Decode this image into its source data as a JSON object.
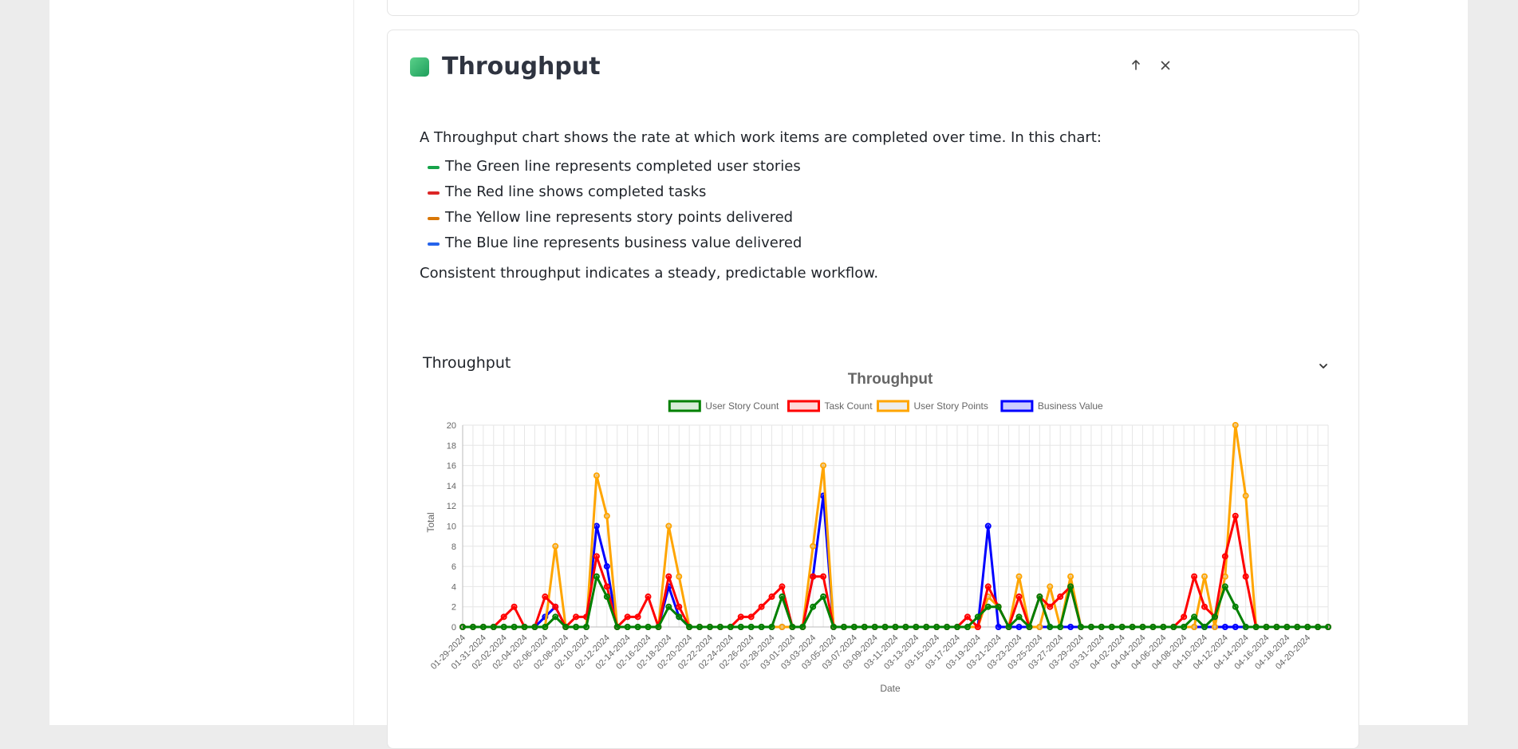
{
  "card": {
    "title": "Throughput",
    "move_up_icon": "arrow-up-icon",
    "close_icon": "close-icon",
    "description": {
      "intro": "A Throughput chart shows the rate at which work items are completed over time. In this chart:",
      "items": [
        {
          "text": "The Green line represents completed user stories",
          "color": "#16a34a"
        },
        {
          "text": "The Red line shows completed tasks",
          "color": "#dc2626"
        },
        {
          "text": "The Yellow line represents story points delivered",
          "color": "#d97706"
        },
        {
          "text": "The Blue line represents business value delivered",
          "color": "#2563eb"
        }
      ],
      "footer": "Consistent throughput indicates a steady, predictable workflow."
    },
    "section": {
      "label": "Throughput",
      "chevron_icon": "chevron-down-icon"
    }
  },
  "chart_data": {
    "type": "line",
    "title": "Throughput",
    "xlabel": "Date",
    "ylabel": "Total",
    "ylim": [
      0,
      20
    ],
    "yticks": [
      0,
      2,
      4,
      6,
      8,
      10,
      12,
      14,
      16,
      18,
      20
    ],
    "grid": true,
    "legend_position": "top",
    "x_tick_labels": [
      "01-29-2024",
      "01-31-2024",
      "02-02-2024",
      "02-04-2024",
      "02-06-2024",
      "02-08-2024",
      "02-10-2024",
      "02-12-2024",
      "02-14-2024",
      "02-16-2024",
      "02-18-2024",
      "02-20-2024",
      "02-22-2024",
      "02-24-2024",
      "02-26-2024",
      "02-28-2024",
      "03-01-2024",
      "03-03-2024",
      "03-05-2024",
      "03-07-2024",
      "03-09-2024",
      "03-11-2024",
      "03-13-2024",
      "03-15-2024",
      "03-17-2024",
      "03-19-2024",
      "03-21-2024",
      "03-23-2024",
      "03-25-2024",
      "03-27-2024",
      "03-29-2024",
      "03-31-2024",
      "04-02-2024",
      "04-04-2024",
      "04-06-2024",
      "04-08-2024",
      "04-10-2024",
      "04-12-2024",
      "04-14-2024",
      "04-16-2024",
      "04-18-2024",
      "04-20-2024"
    ],
    "x_start": "2024-01-29",
    "x_end": "2024-04-21",
    "series": [
      {
        "name": "User Story Count",
        "color": "#008000",
        "fill": "rgba(0,128,0,0.15)",
        "values": [
          0,
          0,
          0,
          0,
          0,
          0,
          0,
          0,
          0,
          1,
          0,
          0,
          0,
          5,
          3,
          0,
          0,
          0,
          0,
          0,
          2,
          1,
          0,
          0,
          0,
          0,
          0,
          0,
          0,
          0,
          0,
          3,
          0,
          0,
          2,
          3,
          0,
          0,
          0,
          0,
          0,
          0,
          0,
          0,
          0,
          0,
          0,
          0,
          0,
          0,
          1,
          2,
          2,
          0,
          1,
          0,
          3,
          0,
          0,
          4,
          0,
          0,
          0,
          0,
          0,
          0,
          0,
          0,
          0,
          0,
          0,
          1,
          0,
          1,
          4,
          2,
          0,
          0,
          0,
          0,
          0,
          0,
          0,
          0,
          0
        ]
      },
      {
        "name": "Task Count",
        "color": "#ff0000",
        "fill": "rgba(255,0,0,0.15)",
        "values": [
          0,
          0,
          0,
          0,
          1,
          2,
          0,
          0,
          3,
          2,
          0,
          1,
          1,
          7,
          4,
          0,
          1,
          1,
          3,
          0,
          5,
          2,
          0,
          0,
          0,
          0,
          0,
          1,
          1,
          2,
          3,
          4,
          0,
          0,
          5,
          5,
          0,
          0,
          0,
          0,
          0,
          0,
          0,
          0,
          0,
          0,
          0,
          0,
          0,
          1,
          0,
          4,
          2,
          0,
          3,
          0,
          3,
          2,
          3,
          4,
          0,
          0,
          0,
          0,
          0,
          0,
          0,
          0,
          0,
          0,
          1,
          5,
          2,
          1,
          7,
          11,
          5,
          0,
          0,
          0,
          0,
          0,
          0,
          0,
          0
        ]
      },
      {
        "name": "User Story Points",
        "color": "#ffa500",
        "fill": "rgba(220,220,220,0.5)",
        "values": [
          0,
          0,
          0,
          0,
          0,
          0,
          0,
          0,
          0,
          8,
          0,
          0,
          0,
          15,
          11,
          0,
          0,
          0,
          0,
          0,
          10,
          5,
          0,
          0,
          0,
          0,
          0,
          0,
          0,
          0,
          0,
          0,
          0,
          0,
          8,
          16,
          0,
          0,
          0,
          0,
          0,
          0,
          0,
          0,
          0,
          0,
          0,
          0,
          0,
          0,
          0,
          3,
          2,
          0,
          5,
          0,
          0,
          4,
          0,
          5,
          0,
          0,
          0,
          0,
          0,
          0,
          0,
          0,
          0,
          0,
          0,
          0,
          5,
          0,
          5,
          20,
          13,
          0,
          0,
          0,
          0,
          0,
          0,
          0,
          0
        ]
      },
      {
        "name": "Business Value",
        "color": "#0000ff",
        "fill": "rgba(0,0,255,0.2)",
        "values": [
          0,
          0,
          0,
          0,
          0,
          0,
          0,
          0,
          1,
          2,
          0,
          0,
          0,
          10,
          6,
          0,
          0,
          0,
          0,
          0,
          4,
          1,
          0,
          0,
          0,
          0,
          0,
          0,
          0,
          0,
          0,
          0,
          0,
          0,
          5,
          13,
          0,
          0,
          0,
          0,
          0,
          0,
          0,
          0,
          0,
          0,
          0,
          0,
          0,
          0,
          0,
          10,
          0,
          0,
          0,
          0,
          0,
          0,
          0,
          0,
          0,
          0,
          0,
          0,
          0,
          0,
          0,
          0,
          0,
          0,
          0,
          0,
          0,
          0,
          0,
          0,
          0,
          0,
          0,
          0,
          0,
          0,
          0,
          0,
          0
        ]
      }
    ]
  }
}
